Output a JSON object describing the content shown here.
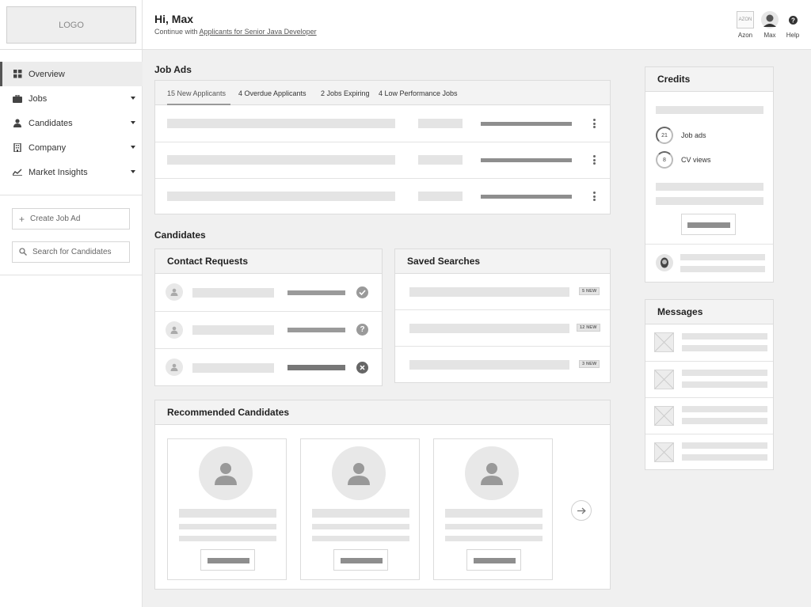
{
  "app": {
    "logo_text": "LOGO"
  },
  "header": {
    "greeting": "Hi, Max",
    "continue_prefix": "Continue with ",
    "continue_link": "Applicants for Senior Java Developer",
    "company_logo_text": "AZON",
    "company_label": "Azon",
    "user_label": "Max",
    "help_label": "Help"
  },
  "sidebar": {
    "items": [
      {
        "label": "Overview",
        "icon": "grid-icon"
      },
      {
        "label": "Jobs",
        "icon": "briefcase-icon"
      },
      {
        "label": "Candidates",
        "icon": "person-icon"
      },
      {
        "label": "Company",
        "icon": "building-icon"
      },
      {
        "label": "Market Insights",
        "icon": "chart-line-icon"
      }
    ],
    "create_job_ad": "Create Job Ad",
    "search_placeholder": "Search for Candidates"
  },
  "job_ads": {
    "title": "Job Ads",
    "tabs": [
      "15 New Applicants",
      "4 Overdue Applicants",
      "2 Jobs Expiring",
      "4 Low Performance Jobs"
    ]
  },
  "candidates": {
    "title": "Candidates",
    "contact_requests": {
      "title": "Contact Requests",
      "statuses": [
        "check",
        "question",
        "declined"
      ]
    },
    "saved_searches": {
      "title": "Saved Searches",
      "badges": [
        "5 NEW",
        "12 NEW",
        "3 NEW"
      ]
    }
  },
  "recommended": {
    "title": "Recommended Candidates"
  },
  "credits": {
    "title": "Credits",
    "job_ads_count": "21",
    "job_ads_label": "Job ads",
    "cv_views_count": "8",
    "cv_views_label": "CV views"
  },
  "messages": {
    "title": "Messages"
  },
  "colors": {
    "accent": "#555555",
    "placeholder": "#e4e4e4",
    "placeholder_dark": "#8e8e8e"
  }
}
